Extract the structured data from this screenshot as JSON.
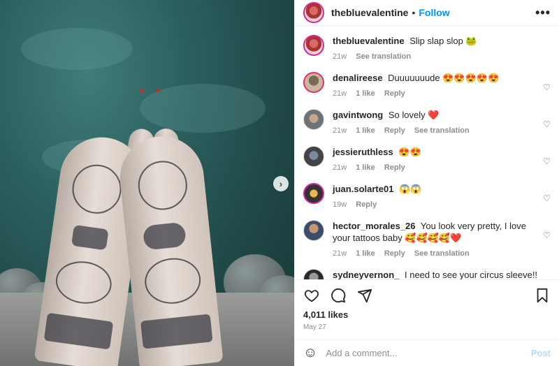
{
  "header": {
    "username": "thebluevalentine",
    "separator": "•",
    "follow_label": "Follow",
    "more_label": "•••"
  },
  "photo": {
    "next_label": "›"
  },
  "caption": {
    "username": "thebluevalentine",
    "text": "Slip slap slop 🐸",
    "time": "21w",
    "translate_label": "See translation"
  },
  "comments": [
    {
      "username": "denalireese",
      "text": "Duuuuuuude 😍😍😍😍😍",
      "time": "21w",
      "likes": "1 like",
      "reply": "Reply",
      "translate": ""
    },
    {
      "username": "gavintwong",
      "text": "So lovely ❤️",
      "time": "21w",
      "likes": "1 like",
      "reply": "Reply",
      "translate": "See translation"
    },
    {
      "username": "jessieruthless",
      "text": "😍😍",
      "time": "21w",
      "likes": "1 like",
      "reply": "Reply",
      "translate": ""
    },
    {
      "username": "juan.solarte01",
      "text": "😱😱",
      "time": "19w",
      "likes": "",
      "reply": "Reply",
      "translate": ""
    },
    {
      "username": "hector_morales_26",
      "text": "You look very pretty, I love your tattoos baby 🥰🥰🥰🥰❤️",
      "time": "21w",
      "likes": "1 like",
      "reply": "Reply",
      "translate": "See translation"
    },
    {
      "username": "sydneyvernon_",
      "text": "I need to see your circus sleeve!! Working on a trad circus sleeve on my leg right now 🥹🥹🥹",
      "time": "",
      "likes": "",
      "reply": "",
      "translate": ""
    }
  ],
  "heart_icon": "♡",
  "actions": {
    "likes": "4,011 likes",
    "date": "May 27"
  },
  "add_comment": {
    "placeholder": "Add a comment...",
    "post_label": "Post",
    "emoji_icon": "☺"
  }
}
